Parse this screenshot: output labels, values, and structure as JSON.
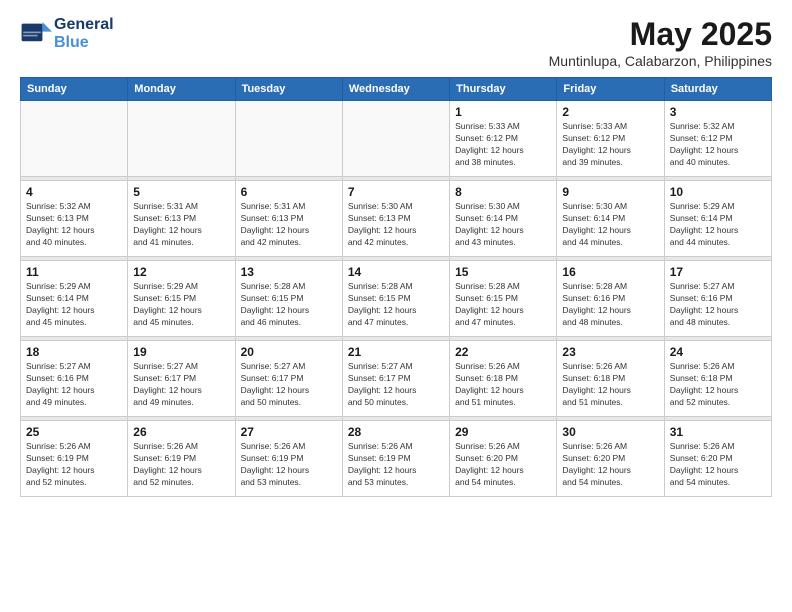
{
  "logo": {
    "line1": "General",
    "line2": "Blue"
  },
  "title": "May 2025",
  "location": "Muntinlupa, Calabarzon, Philippines",
  "days_of_week": [
    "Sunday",
    "Monday",
    "Tuesday",
    "Wednesday",
    "Thursday",
    "Friday",
    "Saturday"
  ],
  "weeks": [
    [
      {
        "day": "",
        "info": ""
      },
      {
        "day": "",
        "info": ""
      },
      {
        "day": "",
        "info": ""
      },
      {
        "day": "",
        "info": ""
      },
      {
        "day": "1",
        "info": "Sunrise: 5:33 AM\nSunset: 6:12 PM\nDaylight: 12 hours\nand 38 minutes."
      },
      {
        "day": "2",
        "info": "Sunrise: 5:33 AM\nSunset: 6:12 PM\nDaylight: 12 hours\nand 39 minutes."
      },
      {
        "day": "3",
        "info": "Sunrise: 5:32 AM\nSunset: 6:12 PM\nDaylight: 12 hours\nand 40 minutes."
      }
    ],
    [
      {
        "day": "4",
        "info": "Sunrise: 5:32 AM\nSunset: 6:13 PM\nDaylight: 12 hours\nand 40 minutes."
      },
      {
        "day": "5",
        "info": "Sunrise: 5:31 AM\nSunset: 6:13 PM\nDaylight: 12 hours\nand 41 minutes."
      },
      {
        "day": "6",
        "info": "Sunrise: 5:31 AM\nSunset: 6:13 PM\nDaylight: 12 hours\nand 42 minutes."
      },
      {
        "day": "7",
        "info": "Sunrise: 5:30 AM\nSunset: 6:13 PM\nDaylight: 12 hours\nand 42 minutes."
      },
      {
        "day": "8",
        "info": "Sunrise: 5:30 AM\nSunset: 6:14 PM\nDaylight: 12 hours\nand 43 minutes."
      },
      {
        "day": "9",
        "info": "Sunrise: 5:30 AM\nSunset: 6:14 PM\nDaylight: 12 hours\nand 44 minutes."
      },
      {
        "day": "10",
        "info": "Sunrise: 5:29 AM\nSunset: 6:14 PM\nDaylight: 12 hours\nand 44 minutes."
      }
    ],
    [
      {
        "day": "11",
        "info": "Sunrise: 5:29 AM\nSunset: 6:14 PM\nDaylight: 12 hours\nand 45 minutes."
      },
      {
        "day": "12",
        "info": "Sunrise: 5:29 AM\nSunset: 6:15 PM\nDaylight: 12 hours\nand 45 minutes."
      },
      {
        "day": "13",
        "info": "Sunrise: 5:28 AM\nSunset: 6:15 PM\nDaylight: 12 hours\nand 46 minutes."
      },
      {
        "day": "14",
        "info": "Sunrise: 5:28 AM\nSunset: 6:15 PM\nDaylight: 12 hours\nand 47 minutes."
      },
      {
        "day": "15",
        "info": "Sunrise: 5:28 AM\nSunset: 6:15 PM\nDaylight: 12 hours\nand 47 minutes."
      },
      {
        "day": "16",
        "info": "Sunrise: 5:28 AM\nSunset: 6:16 PM\nDaylight: 12 hours\nand 48 minutes."
      },
      {
        "day": "17",
        "info": "Sunrise: 5:27 AM\nSunset: 6:16 PM\nDaylight: 12 hours\nand 48 minutes."
      }
    ],
    [
      {
        "day": "18",
        "info": "Sunrise: 5:27 AM\nSunset: 6:16 PM\nDaylight: 12 hours\nand 49 minutes."
      },
      {
        "day": "19",
        "info": "Sunrise: 5:27 AM\nSunset: 6:17 PM\nDaylight: 12 hours\nand 49 minutes."
      },
      {
        "day": "20",
        "info": "Sunrise: 5:27 AM\nSunset: 6:17 PM\nDaylight: 12 hours\nand 50 minutes."
      },
      {
        "day": "21",
        "info": "Sunrise: 5:27 AM\nSunset: 6:17 PM\nDaylight: 12 hours\nand 50 minutes."
      },
      {
        "day": "22",
        "info": "Sunrise: 5:26 AM\nSunset: 6:18 PM\nDaylight: 12 hours\nand 51 minutes."
      },
      {
        "day": "23",
        "info": "Sunrise: 5:26 AM\nSunset: 6:18 PM\nDaylight: 12 hours\nand 51 minutes."
      },
      {
        "day": "24",
        "info": "Sunrise: 5:26 AM\nSunset: 6:18 PM\nDaylight: 12 hours\nand 52 minutes."
      }
    ],
    [
      {
        "day": "25",
        "info": "Sunrise: 5:26 AM\nSunset: 6:19 PM\nDaylight: 12 hours\nand 52 minutes."
      },
      {
        "day": "26",
        "info": "Sunrise: 5:26 AM\nSunset: 6:19 PM\nDaylight: 12 hours\nand 52 minutes."
      },
      {
        "day": "27",
        "info": "Sunrise: 5:26 AM\nSunset: 6:19 PM\nDaylight: 12 hours\nand 53 minutes."
      },
      {
        "day": "28",
        "info": "Sunrise: 5:26 AM\nSunset: 6:19 PM\nDaylight: 12 hours\nand 53 minutes."
      },
      {
        "day": "29",
        "info": "Sunrise: 5:26 AM\nSunset: 6:20 PM\nDaylight: 12 hours\nand 54 minutes."
      },
      {
        "day": "30",
        "info": "Sunrise: 5:26 AM\nSunset: 6:20 PM\nDaylight: 12 hours\nand 54 minutes."
      },
      {
        "day": "31",
        "info": "Sunrise: 5:26 AM\nSunset: 6:20 PM\nDaylight: 12 hours\nand 54 minutes."
      }
    ]
  ]
}
